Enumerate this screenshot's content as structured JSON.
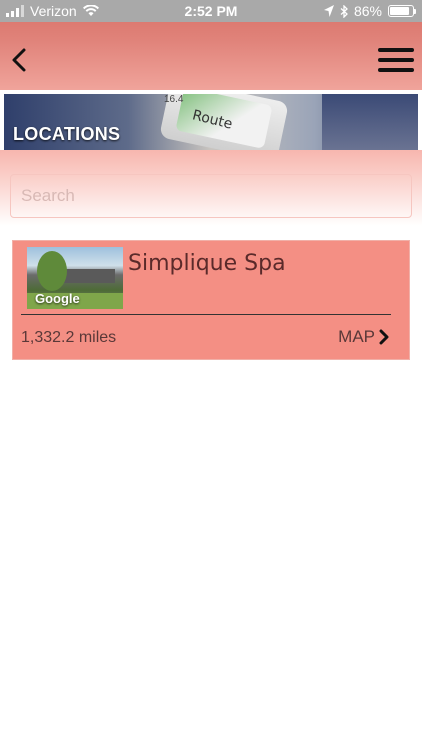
{
  "status_bar": {
    "carrier": "Verizon",
    "time": "2:52 PM",
    "battery_percent": "86%"
  },
  "header": {
    "back_icon": "chevron-left-icon",
    "menu_icon": "hamburger-menu-icon"
  },
  "banner": {
    "title": "LOCATIONS",
    "map_number": "16.4",
    "route_text": "Route"
  },
  "search": {
    "placeholder": "Search",
    "value": ""
  },
  "locations": [
    {
      "name": "Simplique Spa",
      "distance": "1,332.2 miles",
      "map_label": "MAP",
      "thumbnail_watermark": "Google"
    }
  ],
  "colors": {
    "header_gradient_top": "#d86f66",
    "header_gradient_bottom": "#f0a49b",
    "card_background": "#f48f84",
    "status_bar": "#a9a9a9"
  }
}
